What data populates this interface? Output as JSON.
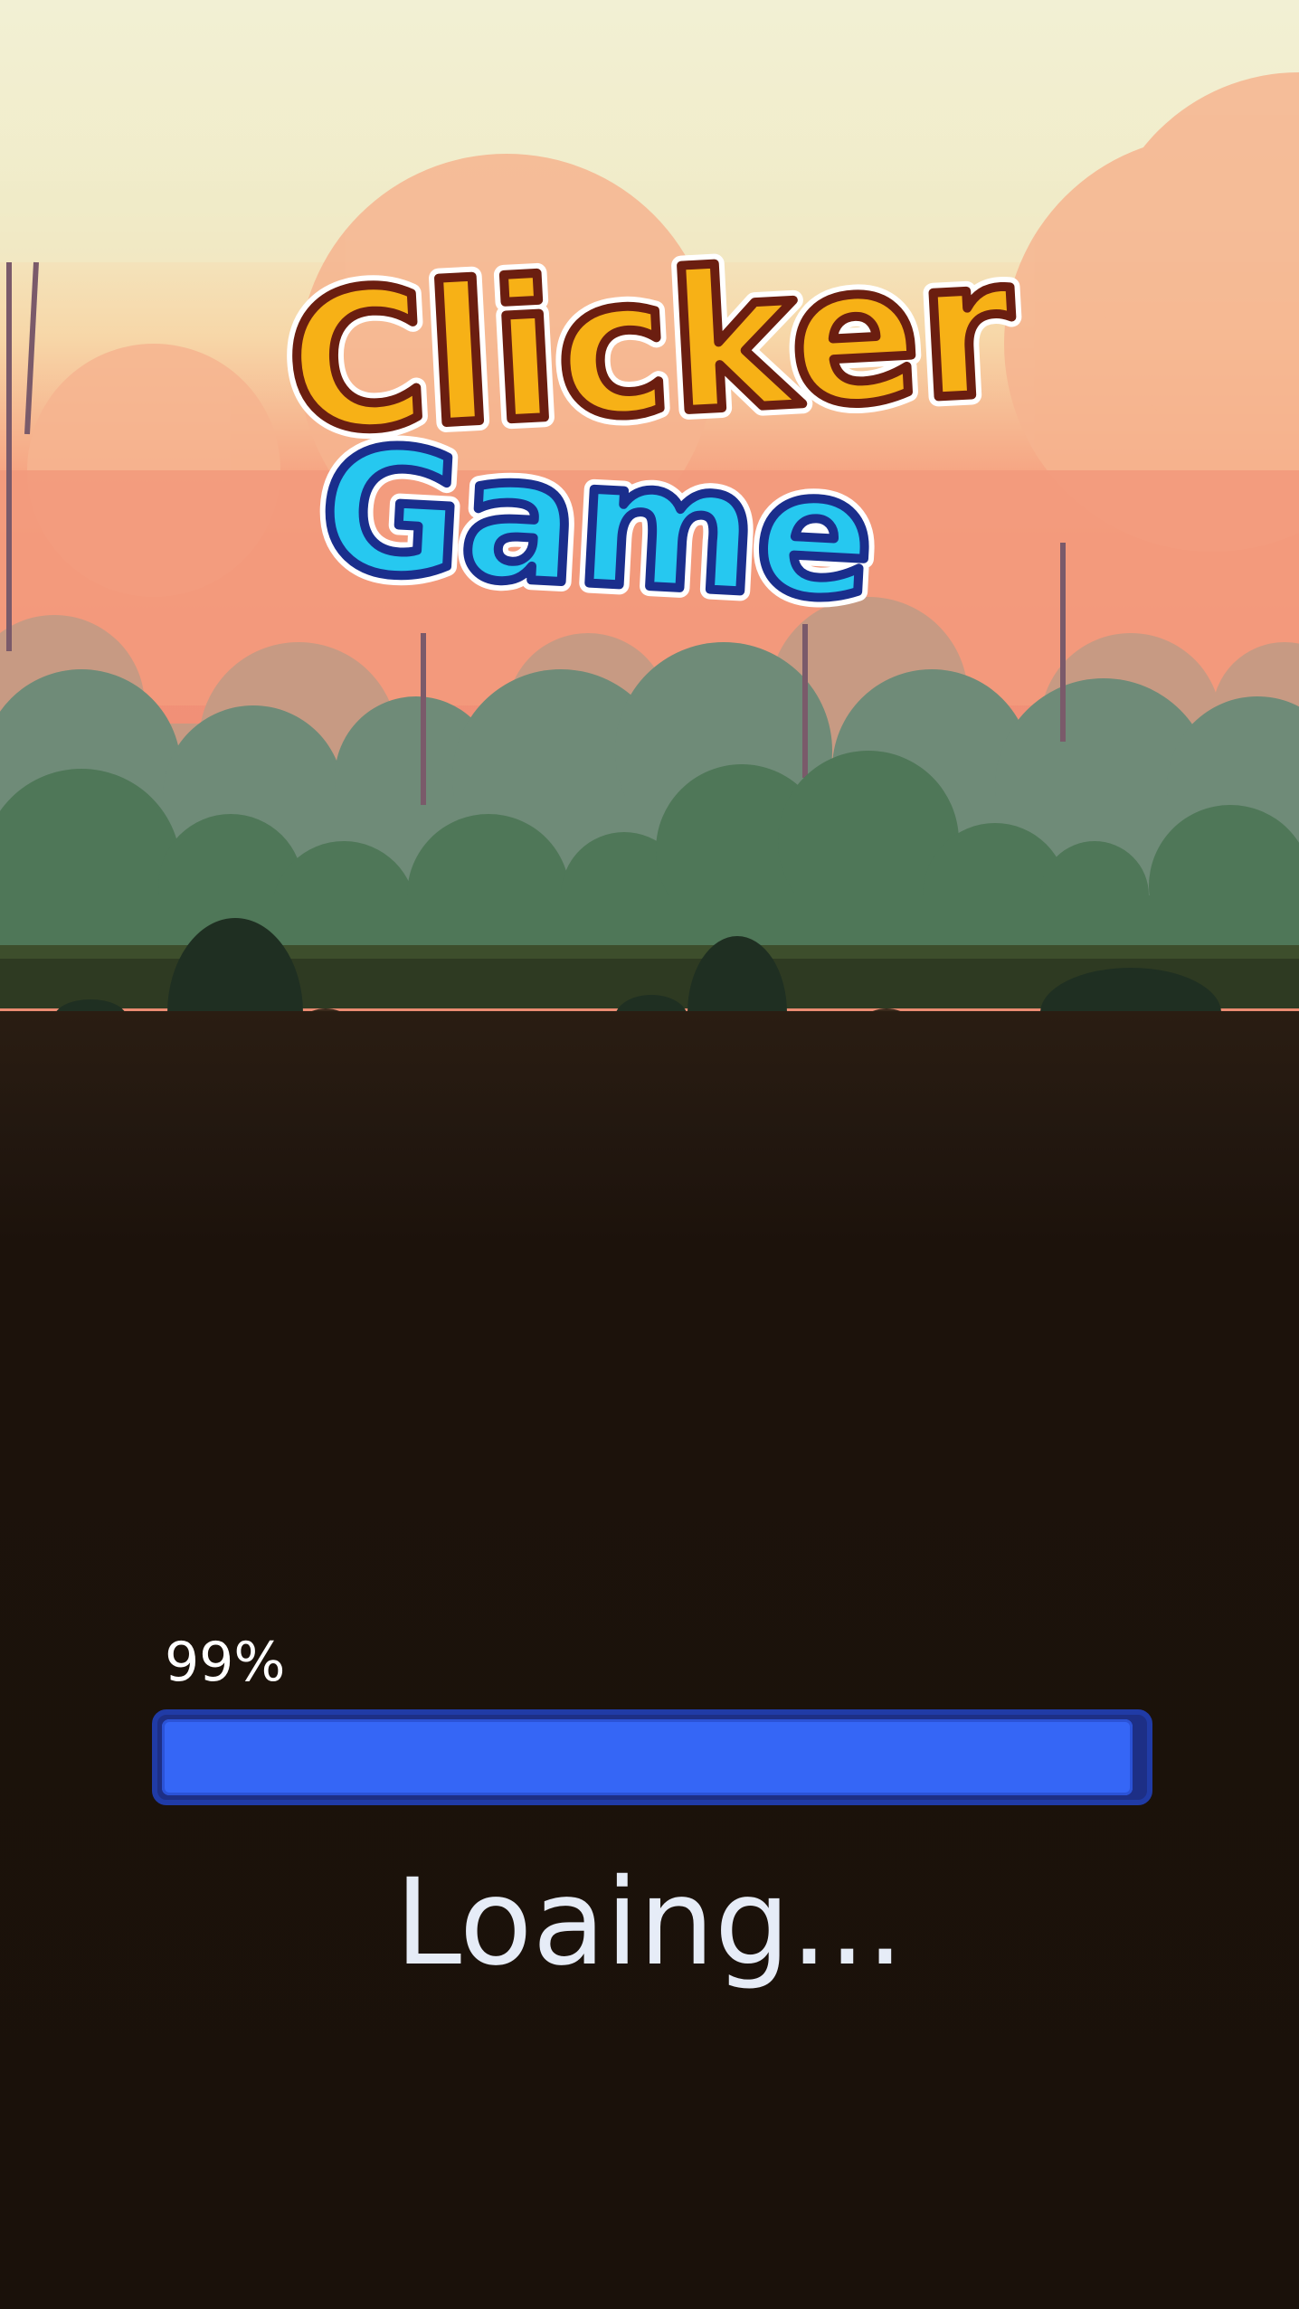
{
  "game": {
    "logo": {
      "line1": "Clicker",
      "line2": "Game"
    },
    "progress": {
      "label": "99%",
      "value": 0.99
    },
    "status_text": "Loaing..."
  },
  "colors": {
    "sky_top": "#f2f0d4",
    "sky_bottom": "#f59a7c",
    "logo_yellow": "#f7b116",
    "logo_cyan": "#26c8f0",
    "bar_fill": "#3566f6",
    "bar_border": "#203ba6",
    "ground": "#1b120b"
  }
}
